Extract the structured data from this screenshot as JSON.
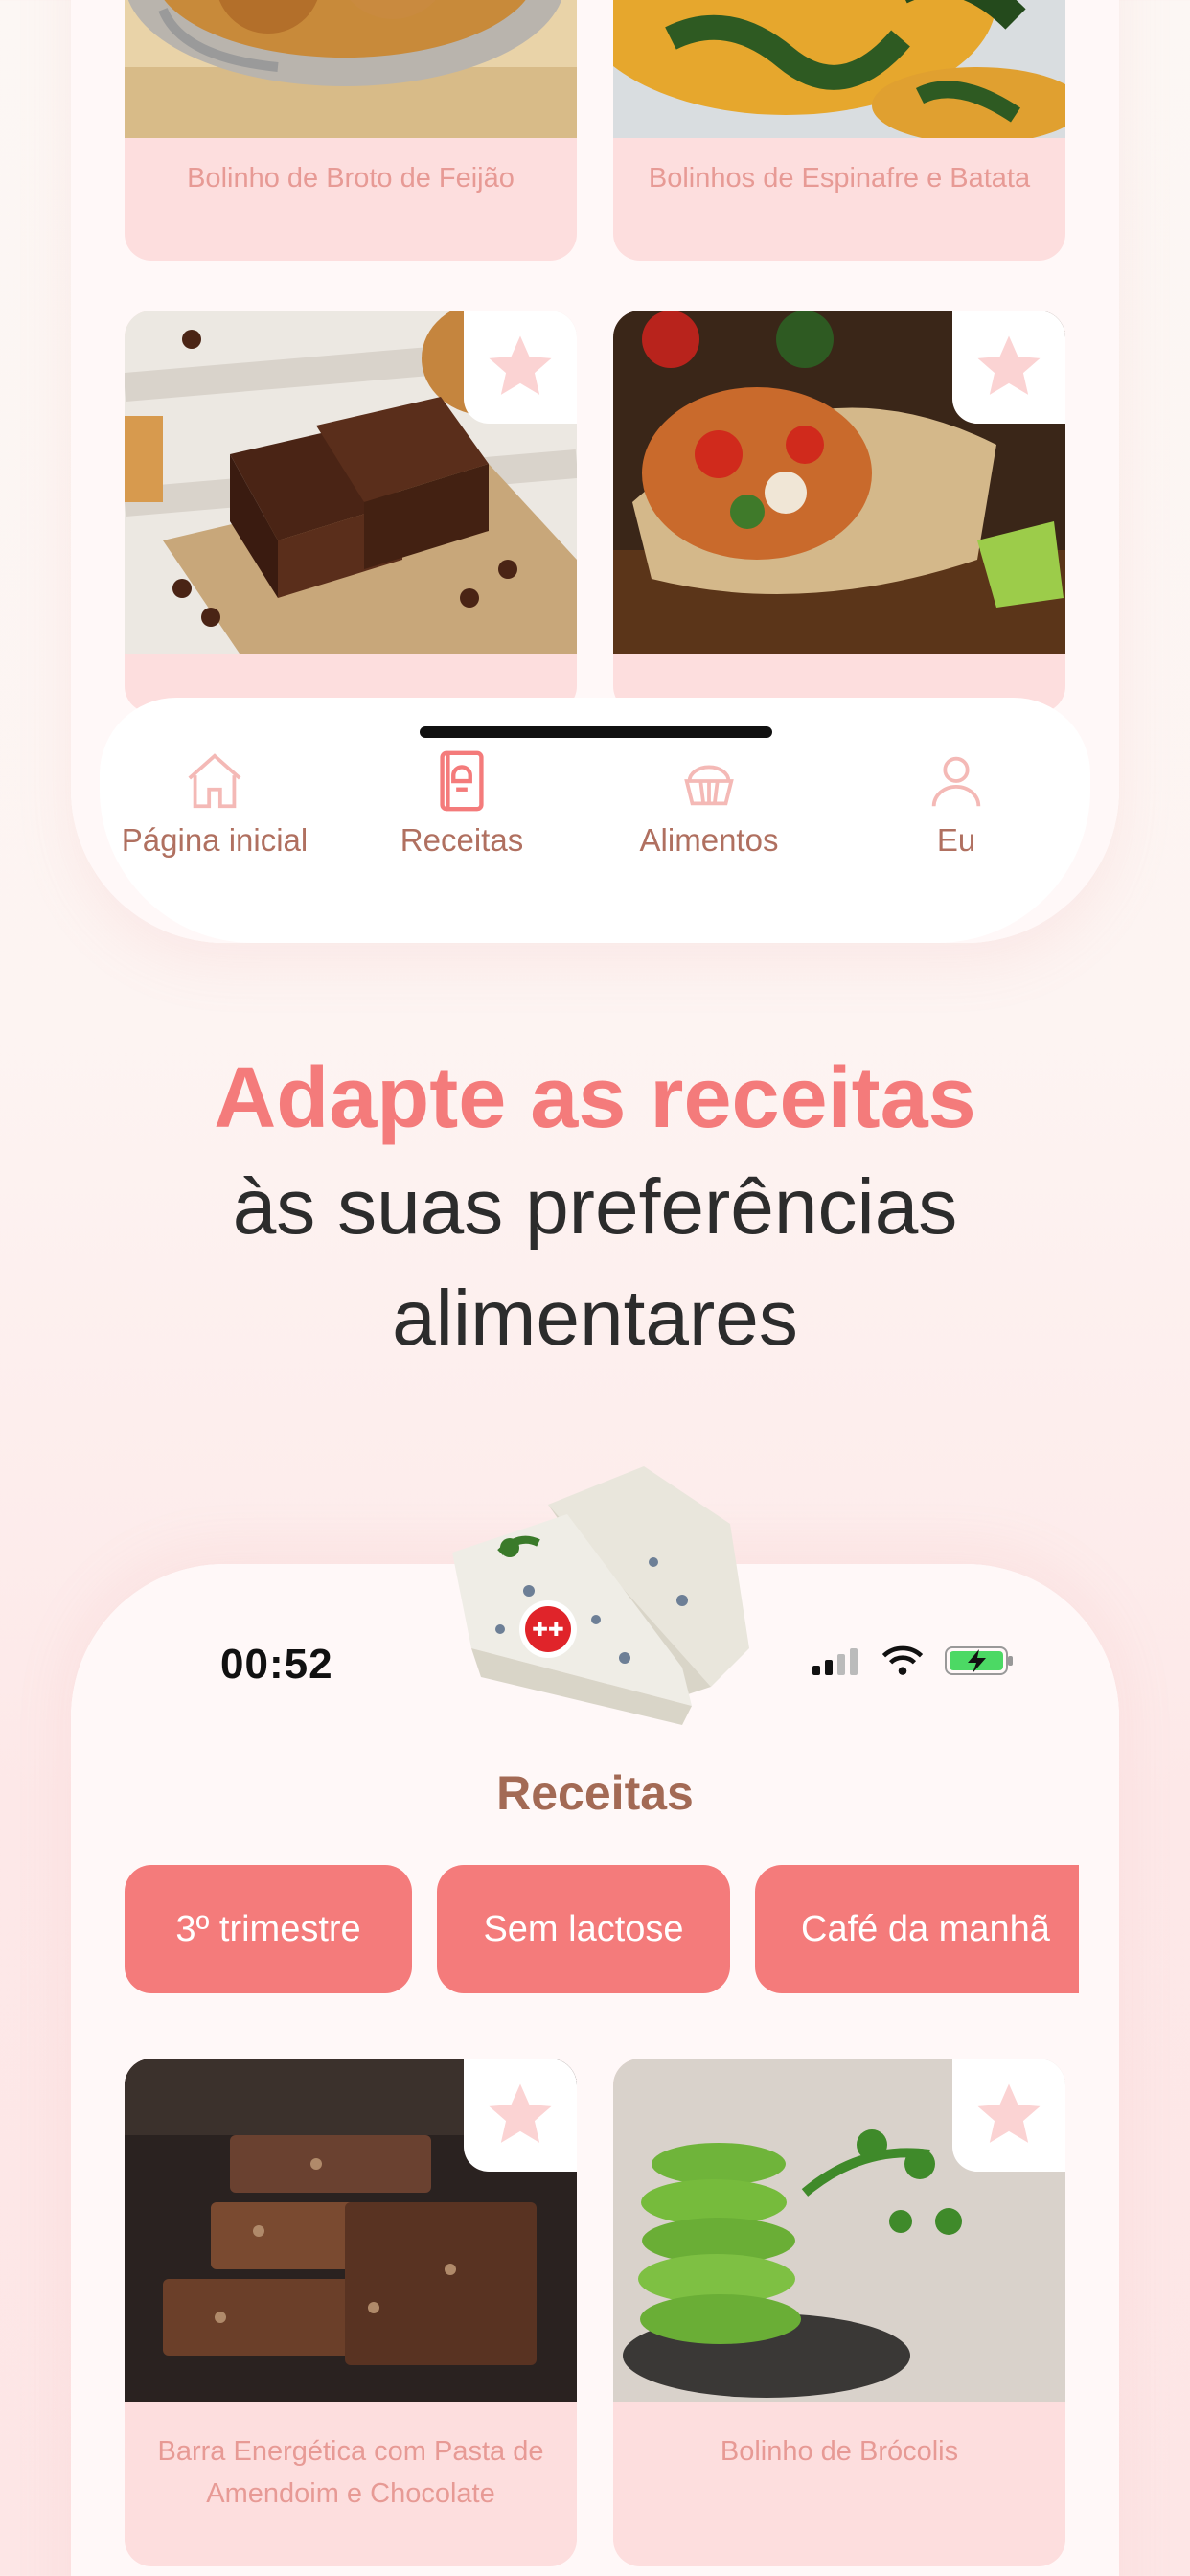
{
  "top_screen": {
    "cards": [
      {
        "title": "Bolinho de Broto de Feijão"
      },
      {
        "title": "Bolinhos de Espinafre e Batata"
      },
      {
        "title": ""
      },
      {
        "title": ""
      }
    ],
    "tabs": [
      {
        "label": "Página inicial",
        "icon": "home-icon"
      },
      {
        "label": "Receitas",
        "icon": "recipe-book-icon"
      },
      {
        "label": "Alimentos",
        "icon": "muffin-icon"
      },
      {
        "label": "Eu",
        "icon": "user-icon"
      }
    ]
  },
  "headline": {
    "accent": "Adapte as receitas",
    "line2": "às suas preferências",
    "line3": "alimentares"
  },
  "bottom_screen": {
    "status_time": "00:52",
    "title": "Receitas",
    "chips": [
      "3º trimestre",
      "Sem lactose",
      "Café da manhã"
    ],
    "cards": [
      {
        "title": "Barra Energética com Pasta de Amendoim e Chocolate"
      },
      {
        "title": "Bolinho de Brócolis"
      }
    ]
  },
  "colors": {
    "accent": "#f47b7b",
    "card_bg": "#fddede",
    "card_text": "#e79a95",
    "tab_text": "#b07060",
    "title_brown": "#a36a55",
    "star": "#fbd3d3"
  }
}
